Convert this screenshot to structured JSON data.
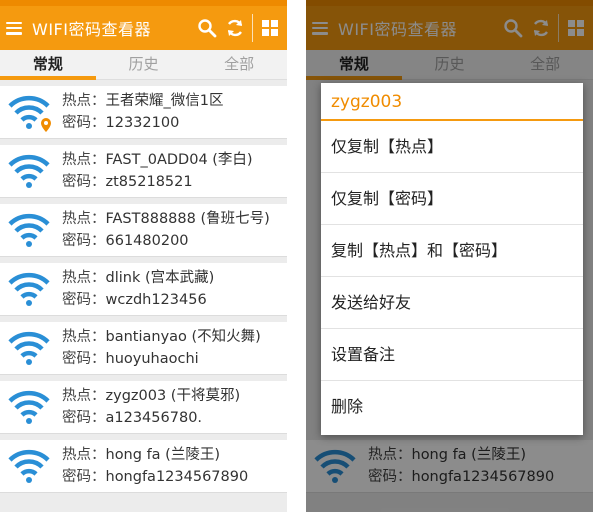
{
  "app": {
    "title": "WIFI密码查看器",
    "accent": "#f59a0f"
  },
  "tabs": [
    {
      "label": "常规",
      "active": true
    },
    {
      "label": "历史",
      "active": false
    },
    {
      "label": "全部",
      "active": false
    }
  ],
  "field_labels": {
    "hotspot": "热点：",
    "password": "密码："
  },
  "networks": [
    {
      "ssid": "王者荣耀_微信1区",
      "password": "12332100",
      "icon": "wifi-location-icon"
    },
    {
      "ssid": "FAST_0ADD04 (李白)",
      "password": "zt85218521",
      "icon": "wifi-icon"
    },
    {
      "ssid": "FAST888888 (鲁班七号)",
      "password": "661480200",
      "icon": "wifi-icon"
    },
    {
      "ssid": "dlink (宫本武藏)",
      "password": "wczdh123456",
      "icon": "wifi-icon"
    },
    {
      "ssid": "bantianyao (不知火舞)",
      "password": "huoyuhaochi",
      "icon": "wifi-icon"
    },
    {
      "ssid": "zygz003 (干将莫邪)",
      "password": "a123456780.",
      "icon": "wifi-icon"
    },
    {
      "ssid": "hong fa (兰陵王)",
      "password": "hongfa1234567890",
      "icon": "wifi-icon"
    }
  ],
  "dialog": {
    "title": "zygz003",
    "options": [
      "仅复制【热点】",
      "仅复制【密码】",
      "复制【热点】和【密码】",
      "发送给好友",
      "设置备注",
      "删除"
    ]
  },
  "right_visible_item": {
    "ssid": "hong fa (兰陵王)",
    "password": "hongfa1234567890"
  }
}
